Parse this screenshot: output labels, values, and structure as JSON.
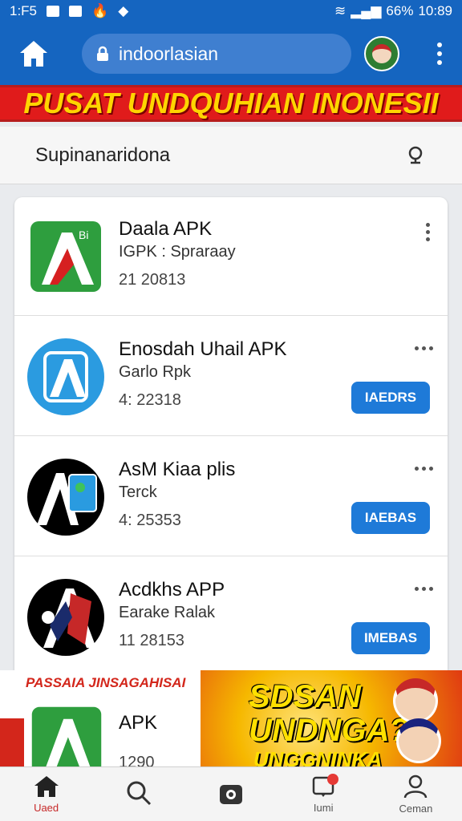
{
  "status": {
    "time_left": "1:F5",
    "battery": "66%",
    "clock": "10:89"
  },
  "appbar": {
    "url": "indoorlasian"
  },
  "banner": {
    "text": "PUSAT UNDQUHIAN INONESII"
  },
  "search": {
    "text": "Supinanaridona"
  },
  "apps": [
    {
      "name": "Daala APK",
      "sub": "IGPK : Spraraay",
      "num": "21 20813",
      "has_button": false,
      "more": "vertical"
    },
    {
      "name": "Enosdah Uhail APK",
      "sub": "Garlo Rpk",
      "num": "4: 22318",
      "has_button": true,
      "button": "IAEDRS",
      "more": "horizontal"
    },
    {
      "name": "AsM Kiaa plis",
      "sub": "Terck",
      "num": "4: 25353",
      "has_button": true,
      "button": "IAEBAS",
      "more": "horizontal"
    },
    {
      "name": "Acdkhs APP",
      "sub": "Earake Ralak",
      "num": "11 28153",
      "has_button": true,
      "button": "IMEBAS",
      "more": "horizontal"
    }
  ],
  "ad": {
    "title": "PASSAIA JINSAGAHISAI",
    "big1": "SDSAN",
    "big2": "UNDNGA?",
    "big3": "UNGGNINKA",
    "apk_name": "APK",
    "apk_num": "1290"
  },
  "nav": [
    {
      "label": "Uaed",
      "icon": "home-icon",
      "active": true
    },
    {
      "label": "",
      "icon": "search-icon",
      "active": false
    },
    {
      "label": "",
      "icon": "camera-icon",
      "active": false
    },
    {
      "label": "Iumi",
      "icon": "notification-icon",
      "active": false
    },
    {
      "label": "Ceman",
      "icon": "profile-icon",
      "active": false
    }
  ],
  "colors": {
    "primary": "#1565c0",
    "banner_red": "#e01b1b",
    "banner_yellow": "#ffd500",
    "button_blue": "#1e7ad8"
  }
}
